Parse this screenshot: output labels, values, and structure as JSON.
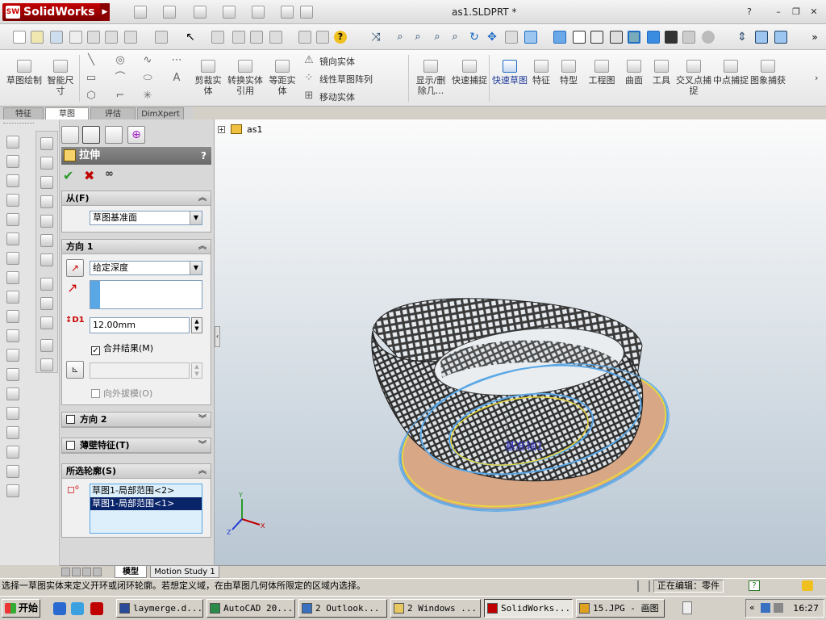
{
  "app": {
    "brand": "SolidWorks",
    "brand_short": "SW",
    "doc_title": "as1.SLDPRT *"
  },
  "window_controls": {
    "help": "?",
    "minimize": "–",
    "restore": "❐",
    "close": "✕"
  },
  "command_manager": {
    "sketch": "草图绘制",
    "smart_dim": "智能尺寸",
    "trim": "剪裁实体",
    "convert": "转换实体引用",
    "offset": "等距实体",
    "mirror": "镜向实体",
    "linear_pattern": "线性草图阵列",
    "move": "移动实体",
    "show_delete": "显示/删除几...",
    "quick_snap": "快速捕捉",
    "quick_sketch": "快速草图",
    "feature": "特征",
    "profile": "特型",
    "drawing": "工程图",
    "surface": "曲面",
    "tools": "工具",
    "intersect_snap": "交叉点捕捉",
    "midpoint_snap": "中点捕捉",
    "image_capture": "图象捕获"
  },
  "cmd_tabs": [
    "特征",
    "草图",
    "评估",
    "DimXpert"
  ],
  "property_manager": {
    "title": "拉伸",
    "help": "?",
    "from": {
      "header": "从(F)",
      "value": "草图基准面"
    },
    "direction1": {
      "header": "方向 1",
      "end_condition": "给定深度",
      "depth": "12.00mm",
      "merge_label": "合并结果(M)",
      "merge_checked": true,
      "draft_outward": "向外拔模(O)"
    },
    "direction2": {
      "header": "方向 2"
    },
    "thin": {
      "header": "薄壁特征(T)"
    },
    "contours": {
      "header": "所选轮廓(S)",
      "items": [
        "草图1-局部范围<2>",
        "草图1-局部范围<1>"
      ],
      "selected_index": 1
    }
  },
  "viewport": {
    "tree_root": "as1",
    "axis_label": "基准轴1",
    "triad": {
      "x": "X",
      "y": "Y",
      "z": "Z"
    }
  },
  "bottom_tabs": [
    "模型",
    "Motion Study 1"
  ],
  "status": {
    "message": "选择一草图实体来定义开环或闭环轮廓。若想定义域，在由草图几何体所限定的区域内选择。",
    "editing": "正在编辑：零件"
  },
  "taskbar": {
    "start": "开始",
    "buttons": [
      "laymerge.d...",
      "AutoCAD 20...",
      "2 Outlook...",
      "2 Windows ...",
      "SolidWorks...",
      "15.JPG - 画图"
    ],
    "active_index": 4,
    "time": "16:27"
  },
  "colors": {
    "brand_red": "#c40000",
    "selection_blue": "#0a246a",
    "preview_yellow": "#e8d640",
    "sketch_blue": "#5aa7e6",
    "face_tan": "#d8a786"
  }
}
